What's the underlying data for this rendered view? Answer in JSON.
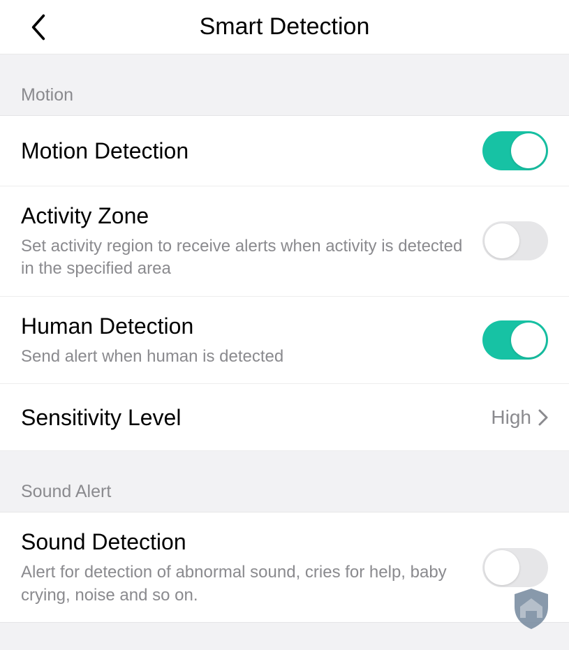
{
  "header": {
    "title": "Smart Detection"
  },
  "sections": {
    "motion": {
      "label": "Motion",
      "motion_detection": {
        "label": "Motion Detection",
        "enabled": true
      },
      "activity_zone": {
        "label": "Activity Zone",
        "desc": "Set activity region to receive alerts when activity is detected in the specified area",
        "enabled": false
      },
      "human_detection": {
        "label": "Human Detection",
        "desc": "Send alert when human is detected",
        "enabled": true
      },
      "sensitivity": {
        "label": "Sensitivity Level",
        "value": "High"
      }
    },
    "sound": {
      "label": "Sound Alert",
      "sound_detection": {
        "label": "Sound Detection",
        "desc": "Alert for detection of abnormal sound, cries for help, baby crying, noise and so on.",
        "enabled": false
      }
    }
  },
  "colors": {
    "accent": "#17c2a4",
    "muted": "#8a8a8e"
  }
}
